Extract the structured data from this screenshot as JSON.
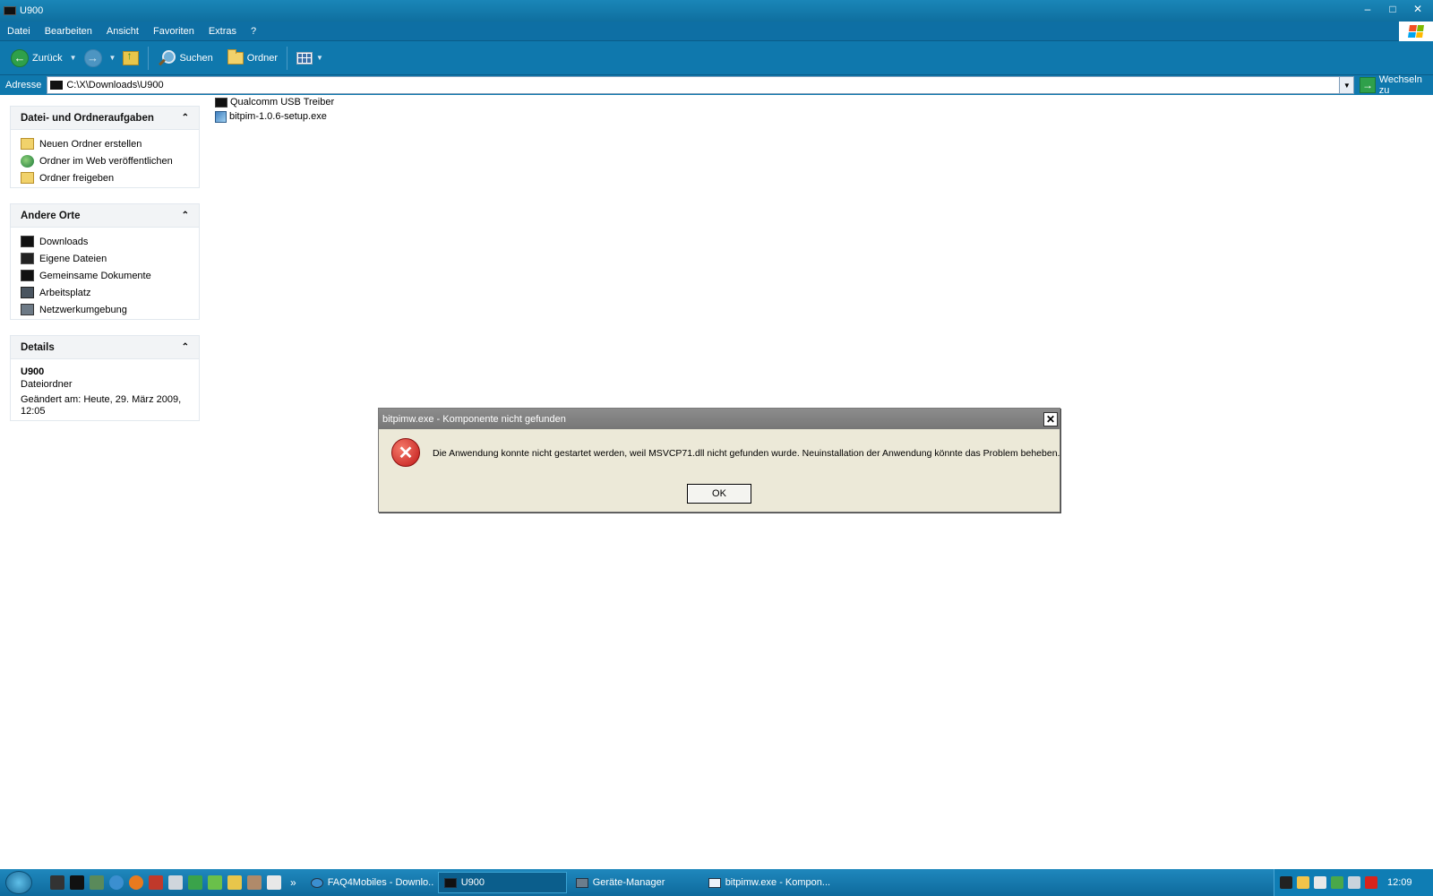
{
  "window": {
    "title": "U900",
    "controls": {
      "minimize": "–",
      "maximize": "□",
      "close": "✕"
    }
  },
  "menu": [
    "Datei",
    "Bearbeiten",
    "Ansicht",
    "Favoriten",
    "Extras",
    "?"
  ],
  "toolbar": {
    "back_label": "Zurück",
    "search_label": "Suchen",
    "folders_label": "Ordner"
  },
  "address": {
    "label": "Adresse",
    "value": "C:\\X\\Downloads\\U900",
    "go_label": "Wechseln zu"
  },
  "taskpane": {
    "tasks": {
      "title": "Datei- und Ordneraufgaben",
      "items": [
        "Neuen Ordner erstellen",
        "Ordner im Web veröffentlichen",
        "Ordner freigeben"
      ]
    },
    "places": {
      "title": "Andere Orte",
      "items": [
        "Downloads",
        "Eigene Dateien",
        "Gemeinsame Dokumente",
        "Arbeitsplatz",
        "Netzwerkumgebung"
      ]
    },
    "details": {
      "title": "Details",
      "name": "U900",
      "type": "Dateiordner",
      "modified": "Geändert am: Heute, 29. März 2009, 12:05"
    },
    "collapse_glyph": "⌃"
  },
  "files": [
    "Qualcomm USB Treiber",
    "bitpim-1.0.6-setup.exe"
  ],
  "dialog": {
    "title": "bitpimw.exe - Komponente nicht gefunden",
    "message": "Die Anwendung konnte nicht gestartet werden, weil MSVCP71.dll nicht gefunden wurde. Neuinstallation der Anwendung könnte das Problem beheben.",
    "ok_label": "OK",
    "close_glyph": "✕",
    "error_glyph": "✕"
  },
  "taskbar": {
    "overflow": "»",
    "tasks": [
      {
        "label": "FAQ4Mobiles - Downlo...",
        "active": false
      },
      {
        "label": "U900",
        "active": true
      },
      {
        "label": "Geräte-Manager",
        "active": false
      },
      {
        "label": "bitpimw.exe - Kompon...",
        "active": false
      }
    ],
    "clock": "12:09"
  },
  "colors": {
    "titlebar": "#1a86b8",
    "taskbar": "#1f88bd",
    "dialog_bg": "#ece9d8"
  }
}
